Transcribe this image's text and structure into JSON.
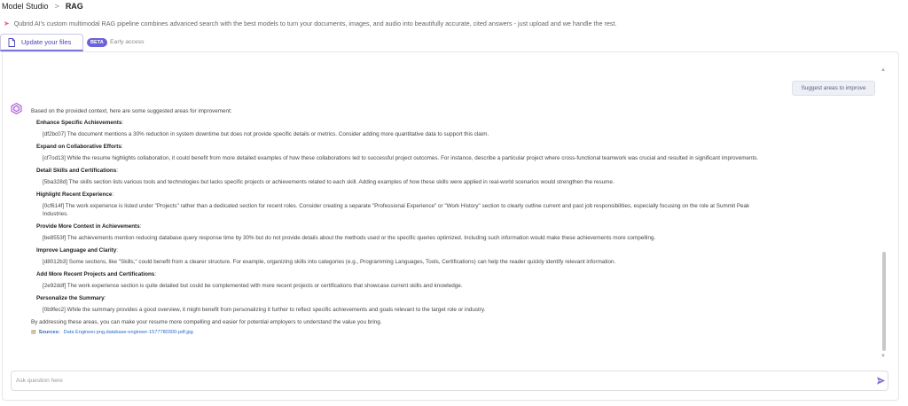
{
  "breadcrumb": {
    "parent": "Model Studio",
    "separator": ">",
    "current": "RAG"
  },
  "subtitle": {
    "text": "Qubrid AI's custom multimodal RAG pipeline combines advanced search with the best models to turn your documents, images, and audio into beautifully accurate, cited answers - just upload and we handle the rest."
  },
  "tabs": {
    "update_label": "Update your files",
    "beta_badge": "BETA",
    "early_access": "Early access"
  },
  "chat": {
    "suggest_button": "Suggest areas to improve",
    "intro": "Based on the provided context, here are some suggested areas for improvement:",
    "items": [
      {
        "heading": "Enhance Specific Achievements",
        "detail": "[df2bc07] The document mentions a 30% reduction in system downtime but does not provide specific details or metrics. Consider adding more quantitative data to support this claim."
      },
      {
        "heading": "Expand on Collaborative Efforts",
        "detail": "[cf7od13] While the resume highlights collaboration, it could benefit from more detailed examples of how these collaborations led to successful project outcomes. For instance, describe a particular project where cross-functional teamwork was crucial and resulted in significant improvements."
      },
      {
        "heading": "Detail Skills and Certifications",
        "detail": "[5ba328d] The skills section lists various tools and technologies but lacks specific projects or achievements related to each skill. Adding examples of how these skills were applied in real-world scenarios would strengthen the resume."
      },
      {
        "heading": "Highlight Recent Experience",
        "detail": "[0cf614f] The work experience is listed under \"Projects\" rather than a dedicated section for recent roles. Consider creating a separate \"Professional Experience\" or \"Work History\" section to clearly outline current and past job responsibilities, especially focusing on the role at Summit Peak Industries."
      },
      {
        "heading": "Provide More Context in Achievements",
        "detail": "[be8553f] The achievements mention reducing database query response time by 30% but do not provide details about the methods used or the specific queries optimized. Including such information would make these achievements more compelling."
      },
      {
        "heading": "Improve Language and Clarity",
        "detail": "[d8012b3] Some sections, like \"Skills,\" could benefit from a clearer structure. For example, organizing skills into categories (e.g., Programming Languages, Tools, Certifications) can help the reader quickly identify relevant information."
      },
      {
        "heading": "Add More Recent Projects and Certifications",
        "detail": "[2e92ddf] The work experience section is quite detailed but could be complemented with more recent projects or certifications that showcase current skills and knowledge."
      },
      {
        "heading": "Personalize the Summary",
        "detail": "[0b9fec2] While the summary provides a good overview, it might benefit from personalizing it further to reflect specific achievements and goals relevant to the target role or industry."
      }
    ],
    "outro": "By addressing these areas, you can make your resume more compelling and easier for potential employers to understand the value you bring.",
    "sources_label": "Sources:",
    "source_file": "Data Engineer.png,database-engineer-1577780300-pdf.jpg"
  },
  "input": {
    "placeholder": "Ask question here",
    "value": ""
  },
  "colors": {
    "accent": "#6c63d6",
    "tab_text": "#4b44b8",
    "link": "#2a6cc2"
  },
  "icons": {
    "subtitle": "rocket-icon",
    "tab": "file-icon",
    "avatar": "bot-avatar-icon",
    "sources": "folder-icon",
    "send": "send-icon"
  }
}
